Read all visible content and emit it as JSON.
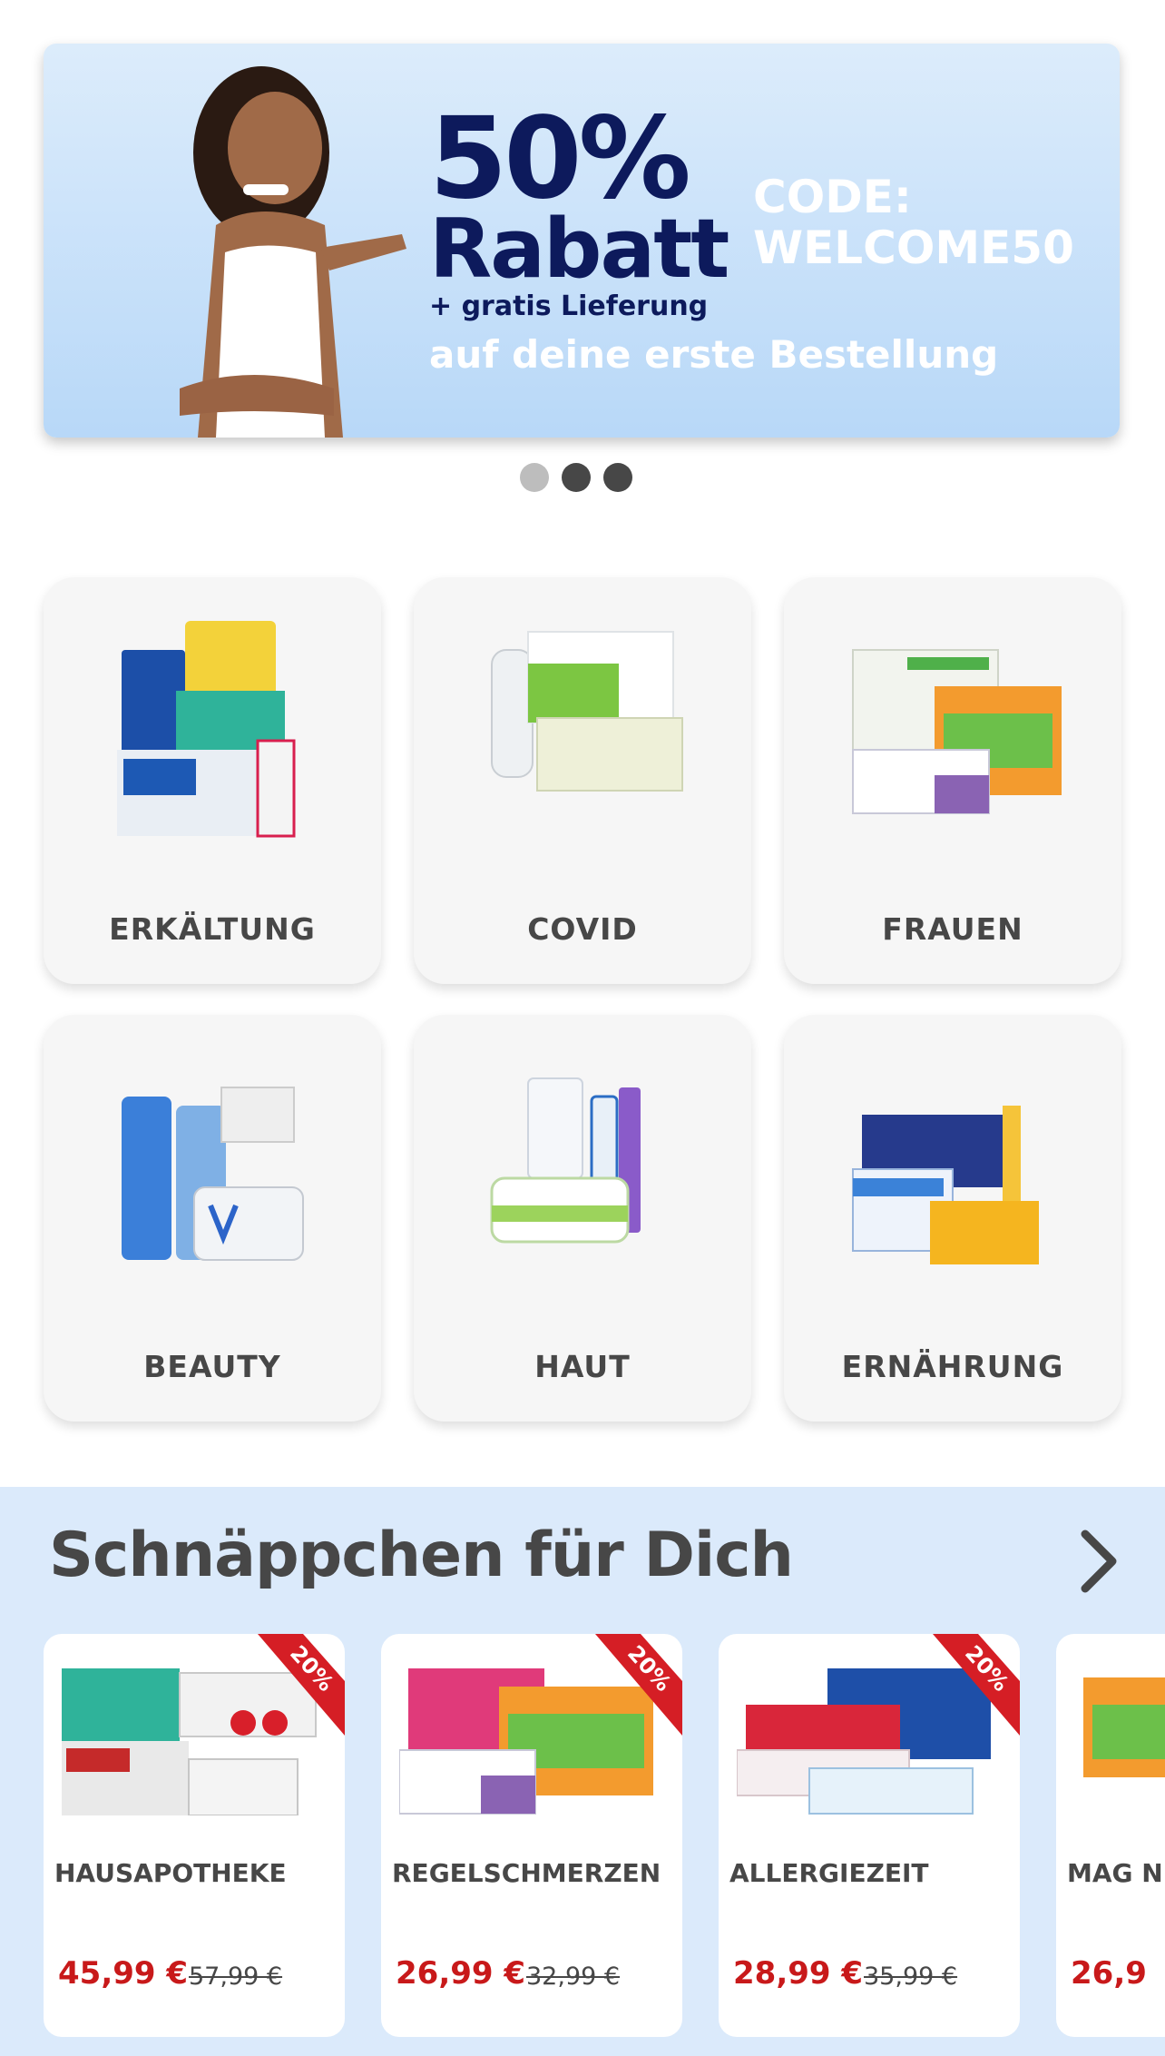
{
  "banner": {
    "percent": "50%",
    "rabatt": "Rabatt",
    "free_delivery": "+ gratis Lieferung",
    "code_label": "CODE:",
    "code_value": "WELCOME50",
    "subtitle": "auf deine erste Bestellung"
  },
  "carousel": {
    "slides": 3,
    "active": 1
  },
  "categories": [
    {
      "label": "ERKÄLTUNG"
    },
    {
      "label": "COVID"
    },
    {
      "label": "FRAUEN"
    },
    {
      "label": "BEAUTY"
    },
    {
      "label": "HAUT"
    },
    {
      "label": "ERNÄHRUNG"
    }
  ],
  "deals": {
    "title": "Schnäppchen für Dich",
    "arrow_icon": "chevron-right-icon",
    "items": [
      {
        "name": "HAUSAPOTHEKE",
        "price": "45,99 €",
        "old_price": "57,99 €",
        "badge": "20%"
      },
      {
        "name": "REGELSCHMERZEN",
        "price": "26,99 €",
        "old_price": "32,99 €",
        "badge": "20%"
      },
      {
        "name": "ALLERGIEZEIT",
        "price": "28,99 €",
        "old_price": "35,99 €",
        "badge": "20%"
      },
      {
        "name": "MAG N",
        "price": "26,9",
        "old_price": "",
        "badge": ""
      }
    ]
  },
  "colors": {
    "accent_navy": "#0d1a5c",
    "price_red": "#c8191a",
    "deals_bg": "#dbeafb",
    "badge_red": "#d51e25"
  }
}
